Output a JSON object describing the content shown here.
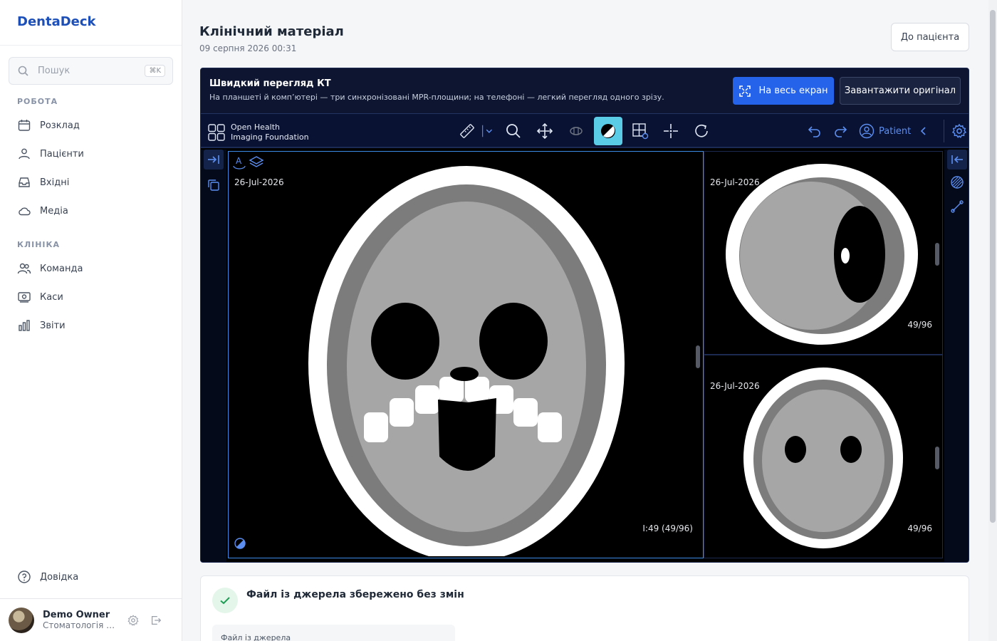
{
  "app": {
    "brand": "DentaDeck"
  },
  "search": {
    "placeholder": "Пошук",
    "shortcut": "⌘K"
  },
  "sidebar": {
    "section_work": "РОБОТА",
    "work_items": [
      {
        "label": "Розклад",
        "icon": "calendar-icon"
      },
      {
        "label": "Пацієнти",
        "icon": "users-icon"
      },
      {
        "label": "Вхідні",
        "icon": "inbox-icon"
      },
      {
        "label": "Медіа",
        "icon": "cloud-icon"
      }
    ],
    "section_clinic": "КЛІНІКА",
    "clinic_items": [
      {
        "label": "Команда",
        "icon": "team-icon"
      },
      {
        "label": "Каси",
        "icon": "cash-icon"
      },
      {
        "label": "Звіти",
        "icon": "chart-icon"
      }
    ],
    "help": "Довідка"
  },
  "user": {
    "name": "Demo Owner",
    "org": "Стоматологія П..."
  },
  "page": {
    "title": "Клінічний матеріал",
    "date": "09 серпня 2026 00:31",
    "to_patient": "До пацієнта"
  },
  "viewer": {
    "title": "Швидкий перегляд КТ",
    "subtitle": "На планшеті й комп’ютері — три синхронізовані MPR-площини; на телефоні — легкий перегляд одного зрізу.",
    "fullscreen": "На весь екран",
    "download": "Завантажити оригінал",
    "ohif_line1": "Open Health",
    "ohif_line2": "Imaging Foundation",
    "patient": "Patient",
    "accent": "#5acce6"
  },
  "viewports": {
    "main": {
      "date": "26-Jul-2026",
      "slice": "I:49 (49/96)"
    },
    "top": {
      "date": "26-Jul-2026",
      "slice": "49/96"
    },
    "bottom": {
      "date": "26-Jul-2026",
      "slice": "49/96"
    }
  },
  "card": {
    "title": "Файл із джерела збережено без змін",
    "field_label": "Файл із джерела"
  }
}
